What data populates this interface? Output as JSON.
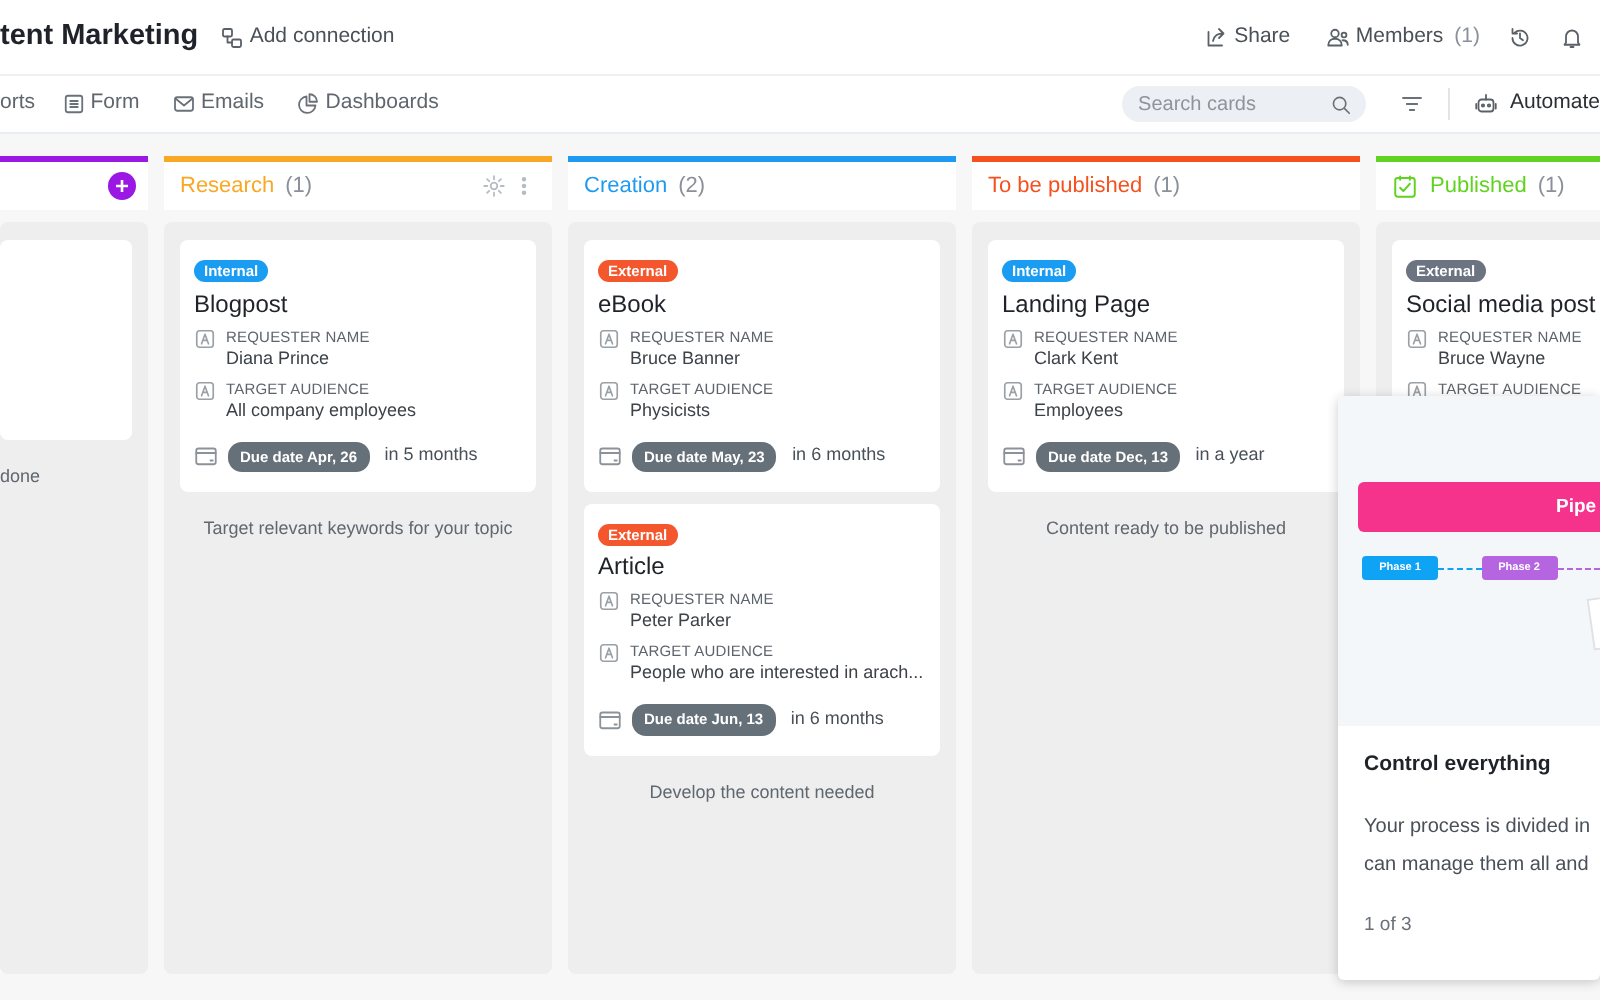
{
  "header": {
    "title": "tent Marketing",
    "add_connection": "Add connection",
    "actions": [
      {
        "kind": "share",
        "label": "Share"
      },
      {
        "kind": "members",
        "label": "Members",
        "count": "(1)"
      },
      {
        "kind": "history"
      },
      {
        "kind": "bell"
      }
    ]
  },
  "nav": {
    "items": [
      {
        "kind": "none",
        "label": "orts"
      },
      {
        "kind": "form",
        "label": "Form"
      },
      {
        "kind": "emails",
        "label": "Emails"
      },
      {
        "kind": "dashboards",
        "label": "Dashboards"
      }
    ],
    "search": {
      "placeholder": "Search cards"
    },
    "automate": "Automate"
  },
  "columns": [
    {
      "color": "#9b17e3",
      "add_button": true,
      "menu_buttons": false,
      "complete": false,
      "cards": [
        {
          "kind": "blank"
        }
      ],
      "note": "done"
    },
    {
      "name": "Research",
      "count": "(1)",
      "color": "#f9a825",
      "add_button": false,
      "menu_buttons": true,
      "complete": false,
      "cards": [
        {
          "kind": "card",
          "tag": {
            "label": "Internal",
            "color": "#1a9cf2"
          },
          "title": "Blogpost",
          "fields": [
            {
              "label": "REQUESTER NAME",
              "value": "Diana Prince"
            },
            {
              "label": "TARGET AUDIENCE",
              "value": "All company employees"
            }
          ],
          "due": "Due date Apr, 26",
          "relative": "in 5 months"
        }
      ],
      "note": "Target relevant keywords for your topic"
    },
    {
      "name": "Creation",
      "count": "(2)",
      "color": "#1e9bf0",
      "add_button": false,
      "menu_buttons": false,
      "complete": false,
      "cards": [
        {
          "kind": "card",
          "tag": {
            "label": "External",
            "color": "#f4572d"
          },
          "title": "eBook",
          "fields": [
            {
              "label": "REQUESTER NAME",
              "value": "Bruce Banner"
            },
            {
              "label": "TARGET AUDIENCE",
              "value": "Physicists"
            }
          ],
          "due": "Due date May, 23",
          "relative": "in 6 months"
        },
        {
          "kind": "card",
          "tag": {
            "label": "External",
            "color": "#f4572d"
          },
          "title": "Article",
          "fields": [
            {
              "label": "REQUESTER NAME",
              "value": "Peter Parker"
            },
            {
              "label": "TARGET AUDIENCE",
              "value": "People who are interested in arach..."
            }
          ],
          "due": "Due date Jun, 13",
          "relative": "in 6 months"
        }
      ],
      "note": "Develop the content needed"
    },
    {
      "name": "To be published",
      "count": "(1)",
      "color": "#f4511e",
      "add_button": false,
      "menu_buttons": false,
      "complete": false,
      "cards": [
        {
          "kind": "card",
          "tag": {
            "label": "Internal",
            "color": "#1a9cf2"
          },
          "title": "Landing Page",
          "fields": [
            {
              "label": "REQUESTER NAME",
              "value": "Clark Kent"
            },
            {
              "label": "TARGET AUDIENCE",
              "value": "Employees"
            }
          ],
          "due": "Due date Dec, 13",
          "relative": "in a year"
        }
      ],
      "note": "Content ready to be published"
    },
    {
      "name": "Published",
      "count": "(1)",
      "color": "#5fd31f",
      "add_button": false,
      "menu_buttons": false,
      "complete": true,
      "cards": [
        {
          "kind": "card",
          "tag": {
            "label": "External",
            "color": "#6b7480"
          },
          "title": "Social media post",
          "fields": [
            {
              "label": "REQUESTER NAME",
              "value": "Bruce Wayne"
            },
            {
              "label": "TARGET AUDIENCE"
            }
          ]
        }
      ]
    }
  ],
  "popover": {
    "banner": "Pipe",
    "phases": [
      {
        "label": "Phase 1",
        "color": "#0fa3f5"
      },
      {
        "label": "Phase 2",
        "color": "#b565e0"
      }
    ],
    "title": "Control everything",
    "lines": [
      "Your process is divided in",
      "can manage them all and"
    ],
    "pager": "1 of 3"
  }
}
